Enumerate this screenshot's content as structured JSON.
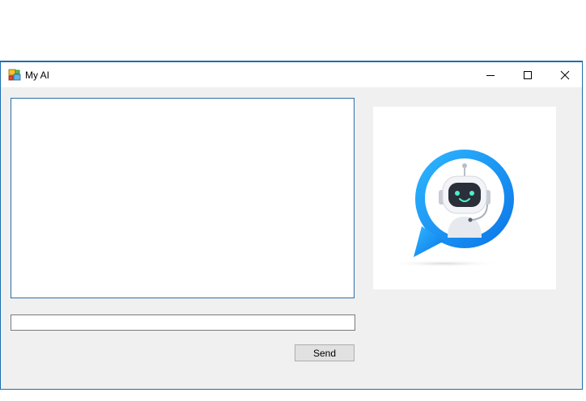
{
  "window": {
    "title": "My AI",
    "icons": {
      "app": "app-icon",
      "minimize": "minimize-icon",
      "maximize": "maximize-icon",
      "close": "close-icon"
    }
  },
  "chat": {
    "log_text": "",
    "input_value": "",
    "send_label": "Send"
  },
  "image": {
    "subject": "robot-chat-bot-icon",
    "colors": {
      "bubble": "#1c9cf6",
      "head": "#2b2f3a",
      "face_glow": "#4ef0c8"
    }
  },
  "colors": {
    "window_border": "#1a6fb0",
    "client_bg": "#f0f0f0",
    "text_box_border": "#2a6fa8"
  }
}
